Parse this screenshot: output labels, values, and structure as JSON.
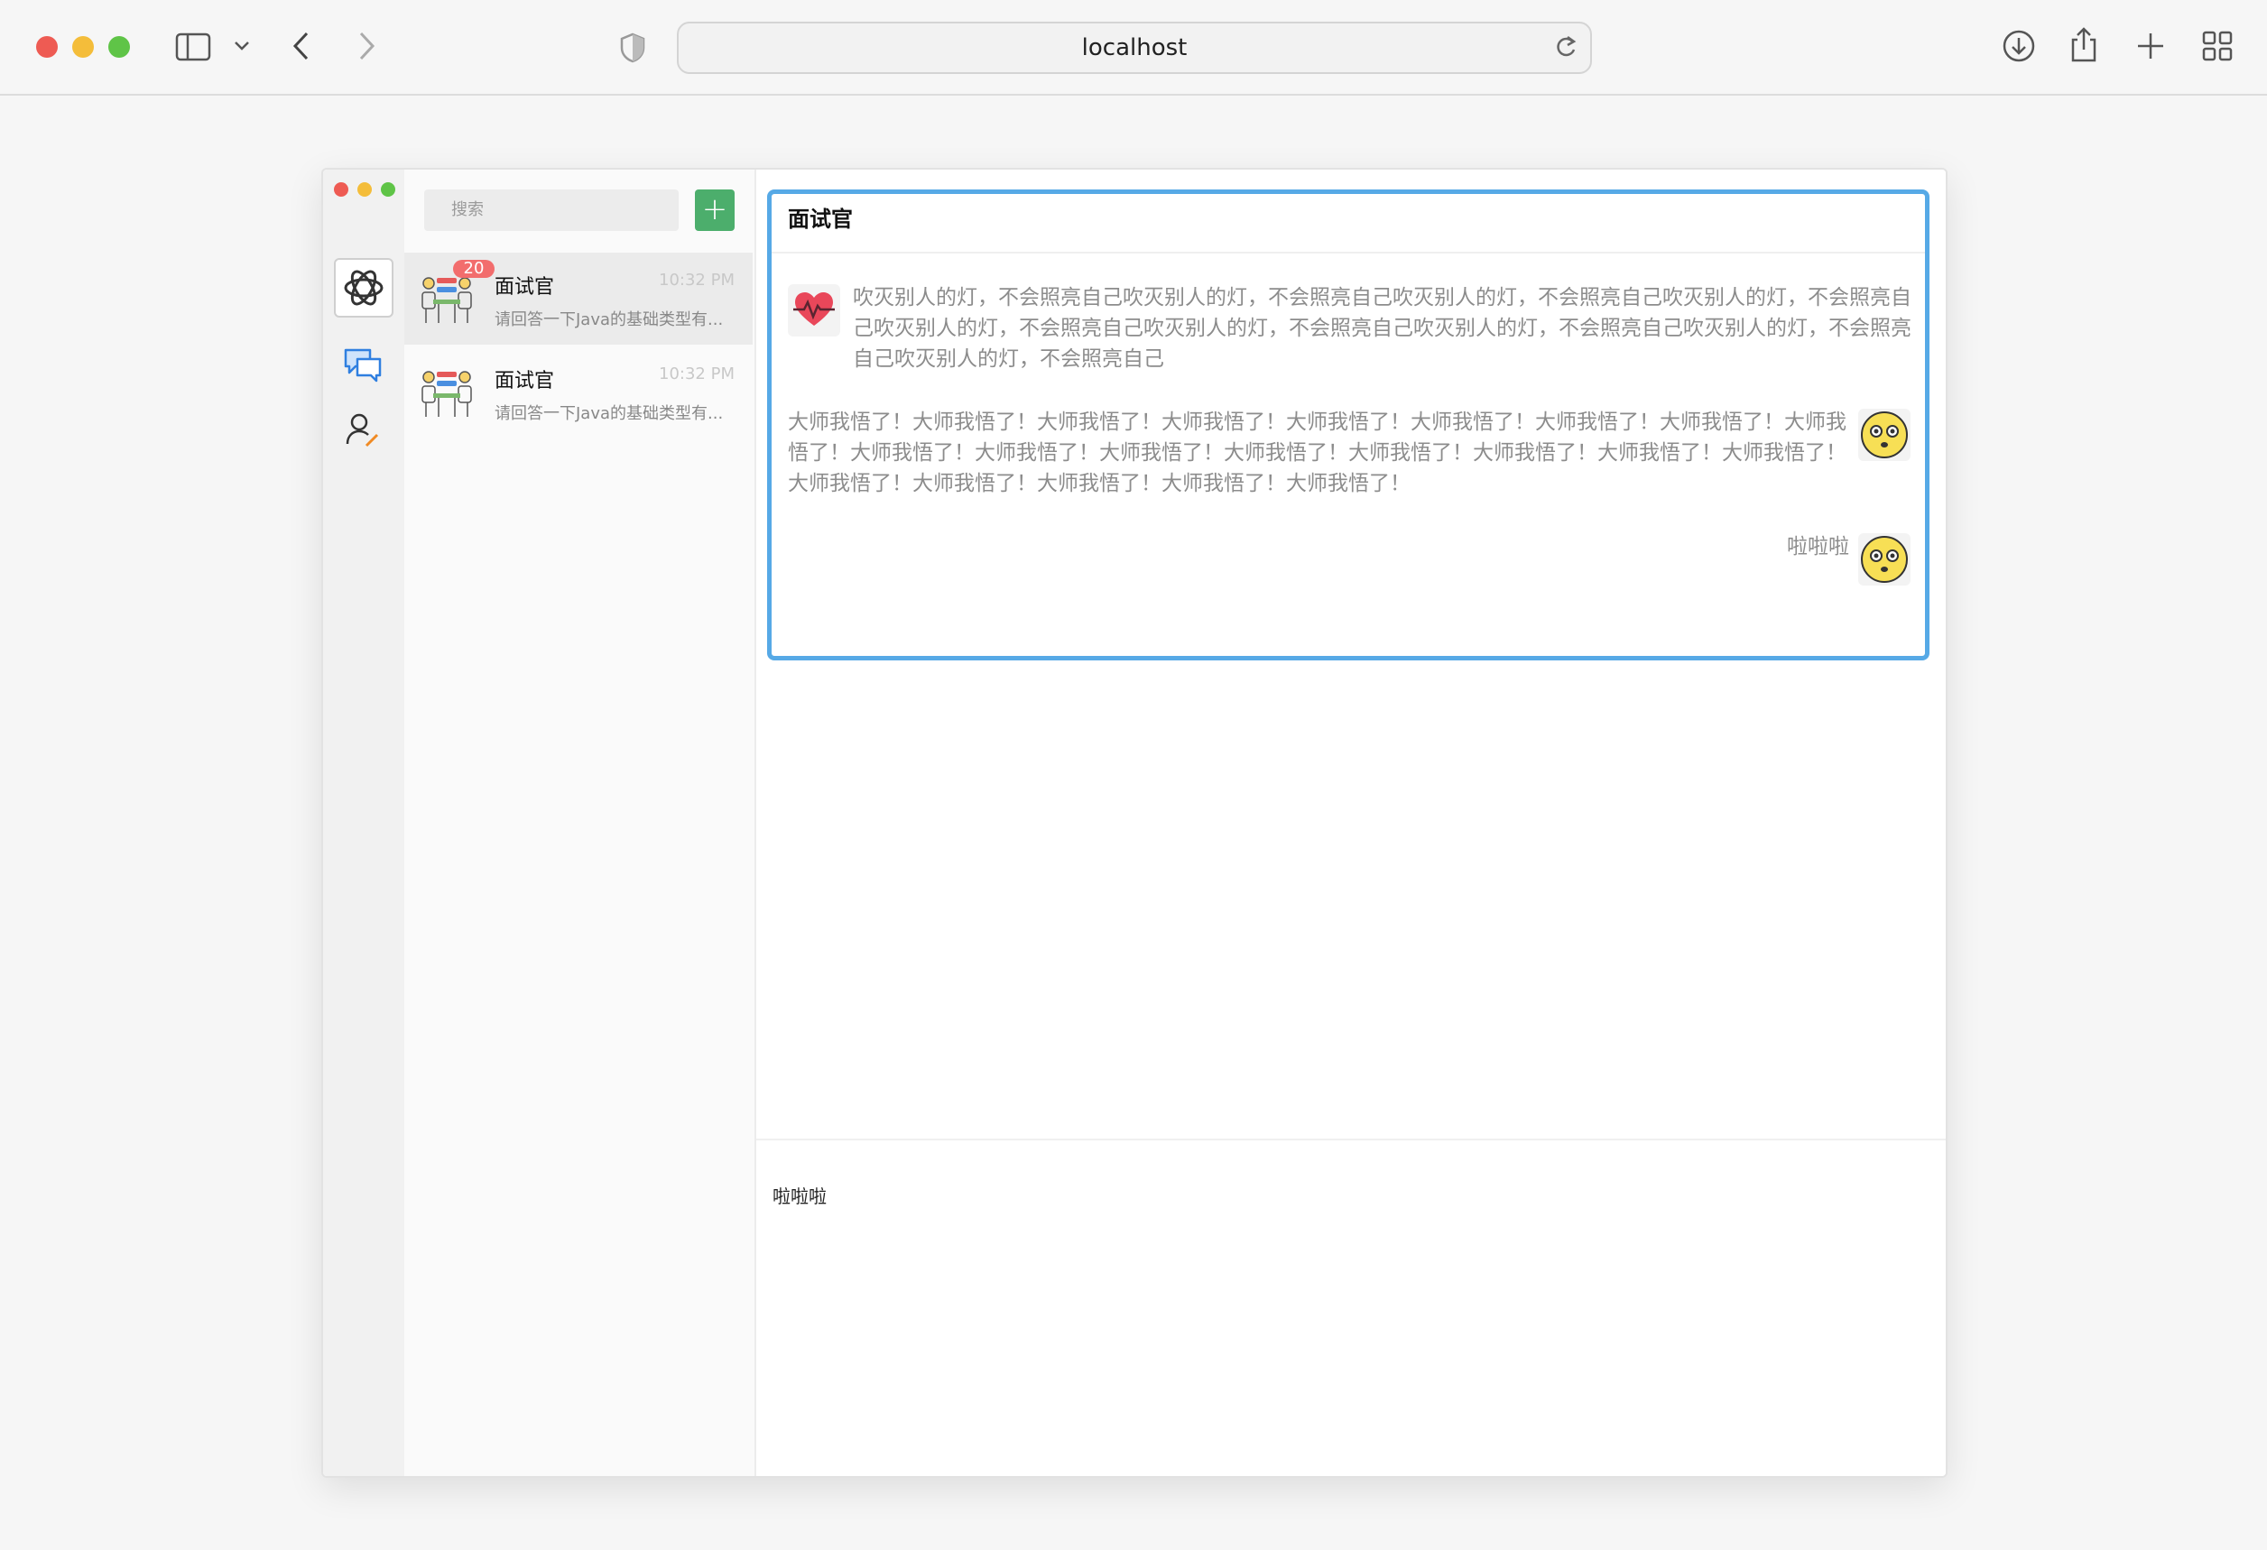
{
  "browser": {
    "url": "localhost"
  },
  "search": {
    "placeholder": "搜索"
  },
  "add_button": {
    "label": "+"
  },
  "conversations": [
    {
      "name": "面试官",
      "time": "10:32 PM",
      "preview": "请回答一下Java的基础类型有...",
      "badge": "20",
      "active": true
    },
    {
      "name": "面试官",
      "time": "10:32 PM",
      "preview": "请回答一下Java的基础类型有...",
      "badge": "",
      "active": false
    }
  ],
  "chat": {
    "title": "面试官",
    "messages": [
      {
        "side": "left",
        "avatar": "heart-pulse-icon",
        "text": "吹灭别人的灯，不会照亮自己吹灭别人的灯，不会照亮自己吹灭别人的灯，不会照亮自己吹灭别人的灯，不会照亮自己吹灭别人的灯，不会照亮自己吹灭别人的灯，不会照亮自己吹灭别人的灯，不会照亮自己吹灭别人的灯，不会照亮自己吹灭别人的灯，不会照亮自己"
      },
      {
        "side": "right",
        "avatar": "emoji-face-avatar",
        "text": "大师我悟了！大师我悟了！大师我悟了！大师我悟了！大师我悟了！大师我悟了！大师我悟了！大师我悟了！大师我悟了！大师我悟了！大师我悟了！大师我悟了！大师我悟了！大师我悟了！大师我悟了！大师我悟了！大师我悟了！大师我悟了！大师我悟了！大师我悟了！大师我悟了！大师我悟了！"
      },
      {
        "side": "right",
        "avatar": "emoji-face-avatar",
        "text": "啦啦啦"
      }
    ]
  },
  "composer": {
    "value": "啦啦啦"
  },
  "colors": {
    "accent_green": "#4cae6c",
    "focus_blue": "#56a9e6",
    "badge_red": "#f26d6d"
  }
}
